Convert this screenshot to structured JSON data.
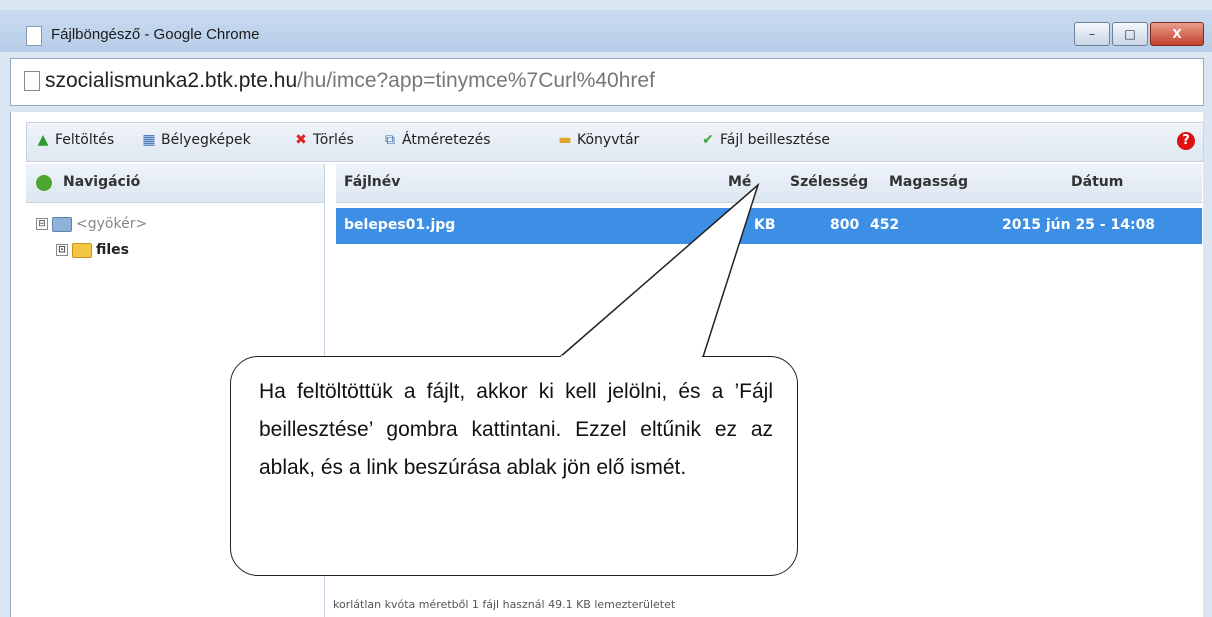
{
  "window": {
    "title": "Fájlböngésző - Google Chrome",
    "controls": {
      "minimize": "–",
      "maximize": "□",
      "close": "X"
    }
  },
  "address": {
    "host": "szocialismunka2.btk.pte.hu",
    "path": "/hu/imce?app=tinymce%7Curl%40href"
  },
  "toolbar": {
    "upload": "Feltöltés",
    "thumbnails": "Bélyegképek",
    "delete": "Törlés",
    "resize": "Átméretezés",
    "directory": "Könyvtár",
    "insert_file": "Fájl beillesztése",
    "help": "?"
  },
  "navigation": {
    "header": "Navigáció",
    "tree": [
      {
        "label": "<gyökér>",
        "expander": "⊟"
      },
      {
        "label": "files",
        "expander": "⊡"
      }
    ]
  },
  "files": {
    "columns": {
      "name": "Fájlnév",
      "size": "Mé",
      "width": "Szélesség",
      "height": "Magasság",
      "date": "Dátum"
    },
    "rows": [
      {
        "name": "belepes01.jpg",
        "size": "KB",
        "width": "800",
        "height": "452",
        "date": "2015 jún 25 - 14:08"
      }
    ]
  },
  "status": "korlátlan kvóta méretből 1 fájl használ 49.1 KB lemezterületet",
  "callout": {
    "text": "Ha feltöltöttük a fájlt, akkor ki kell jelölni, és a ’Fájl beillesztése’ gombra kattintani. Ezzel eltűnik ez az ablak, és a link beszúrása ablak jön elő ismét."
  },
  "colors": {
    "selected_row": "#3d8fe6",
    "toolbar_bg": "#e6edf6",
    "help": "#d11111"
  }
}
